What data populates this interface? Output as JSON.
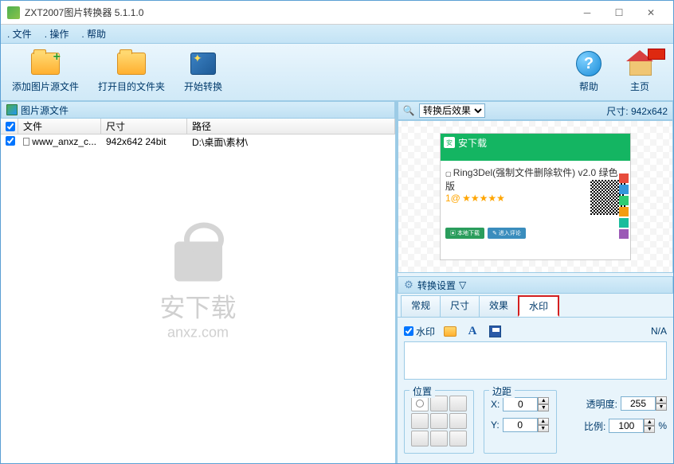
{
  "window": {
    "title": "ZXT2007图片转换器 5.1.1.0"
  },
  "menu": {
    "file": "文件",
    "operate": "操作",
    "help": "帮助"
  },
  "toolbar": {
    "add_source": "添加图片源文件",
    "open_dest": "打开目的文件夹",
    "start_convert": "开始转换",
    "help": "帮助",
    "home": "主页"
  },
  "source_panel": {
    "title": "图片源文件",
    "columns": {
      "file": "文件",
      "size": "尺寸",
      "path": "路径"
    },
    "rows": [
      {
        "checked": true,
        "file": "www_anxz_c...",
        "size": "942x642  24bit",
        "path": "D:\\桌面\\素材\\"
      }
    ],
    "watermark": {
      "line1": "安下载",
      "line2": "anxz.com"
    }
  },
  "preview_panel": {
    "dropdown": "转换后效果",
    "size_label": "尺寸:",
    "size_value": "942x642",
    "sample": {
      "brand": "安下载",
      "title": "Ring3Del(强制文件删除软件) v2.0 绿色版",
      "btn1": "▣ 本地下载",
      "btn2": "✎ 进入评论",
      "stars": "★★★★★",
      "leftlabel": "1@"
    }
  },
  "settings": {
    "title": "转换设置",
    "tabs": {
      "general": "常规",
      "size": "尺寸",
      "effect": "效果",
      "watermark": "水印"
    },
    "watermark": {
      "checkbox": "水印",
      "na": "N/A",
      "position_label": "位置",
      "margin_label": "边距",
      "x_label": "X:",
      "y_label": "Y:",
      "x_value": "0",
      "y_value": "0",
      "opacity_label": "透明度:",
      "opacity_value": "255",
      "scale_label": "比例:",
      "scale_value": "100",
      "percent": "%"
    }
  }
}
